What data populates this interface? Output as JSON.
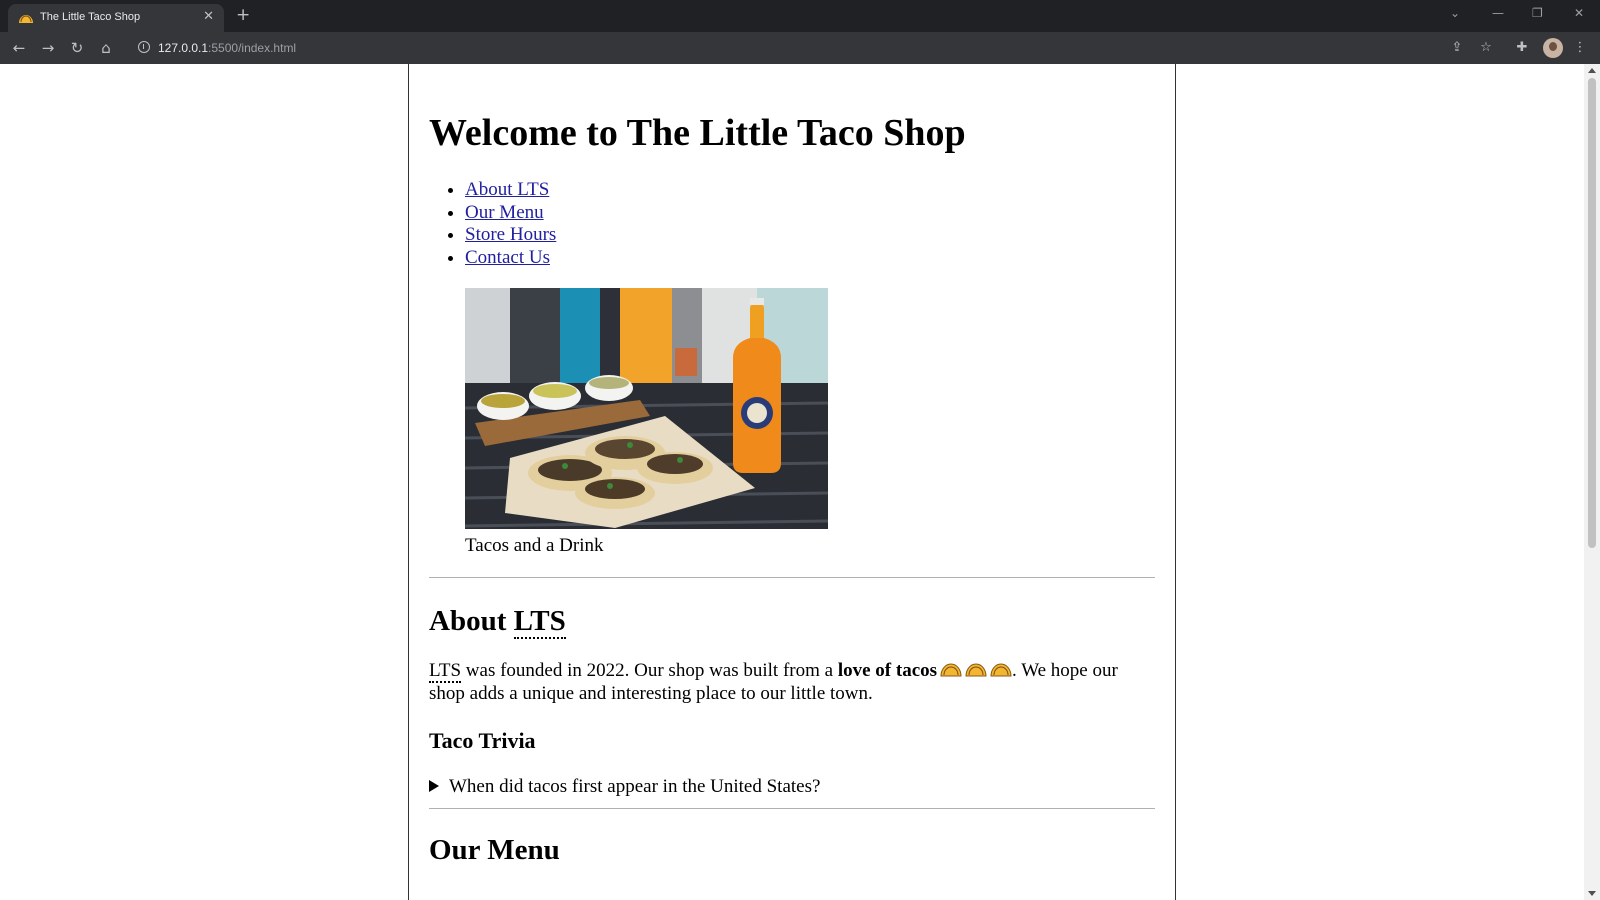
{
  "browser": {
    "tab_title": "The Little Taco Shop",
    "url_host": "127.0.0.1",
    "url_rest": ":5500/index.html"
  },
  "page": {
    "title": "Welcome to The Little Taco Shop",
    "nav": [
      {
        "label": "About LTS"
      },
      {
        "label": "Our Menu"
      },
      {
        "label": "Store Hours"
      },
      {
        "label": "Contact Us"
      }
    ],
    "figure_caption": "Tacos and a Drink",
    "about": {
      "heading_prefix": "About ",
      "heading_abbr": "LTS",
      "para_abbr": "LTS",
      "para_text1": " was founded in 2022. Our shop was built from a ",
      "para_bold": "love of tacos",
      "para_text2": ". We hope our shop adds a unique and interesting place to our little town."
    },
    "trivia": {
      "heading": "Taco Trivia",
      "question": "When did tacos first appear in the United States?"
    },
    "menu_heading": "Our Menu"
  },
  "colors": {
    "link": "#2020a0",
    "chrome_dark": "#202124",
    "chrome_toolbar": "#35363a"
  },
  "icons": [
    "taco-favicon-icon",
    "close-icon",
    "plus-icon",
    "back-icon",
    "forward-icon",
    "reload-icon",
    "home-icon",
    "info-icon",
    "share-icon",
    "star-icon",
    "extensions-icon",
    "menu-dots-icon",
    "taco-emoji-icon"
  ]
}
